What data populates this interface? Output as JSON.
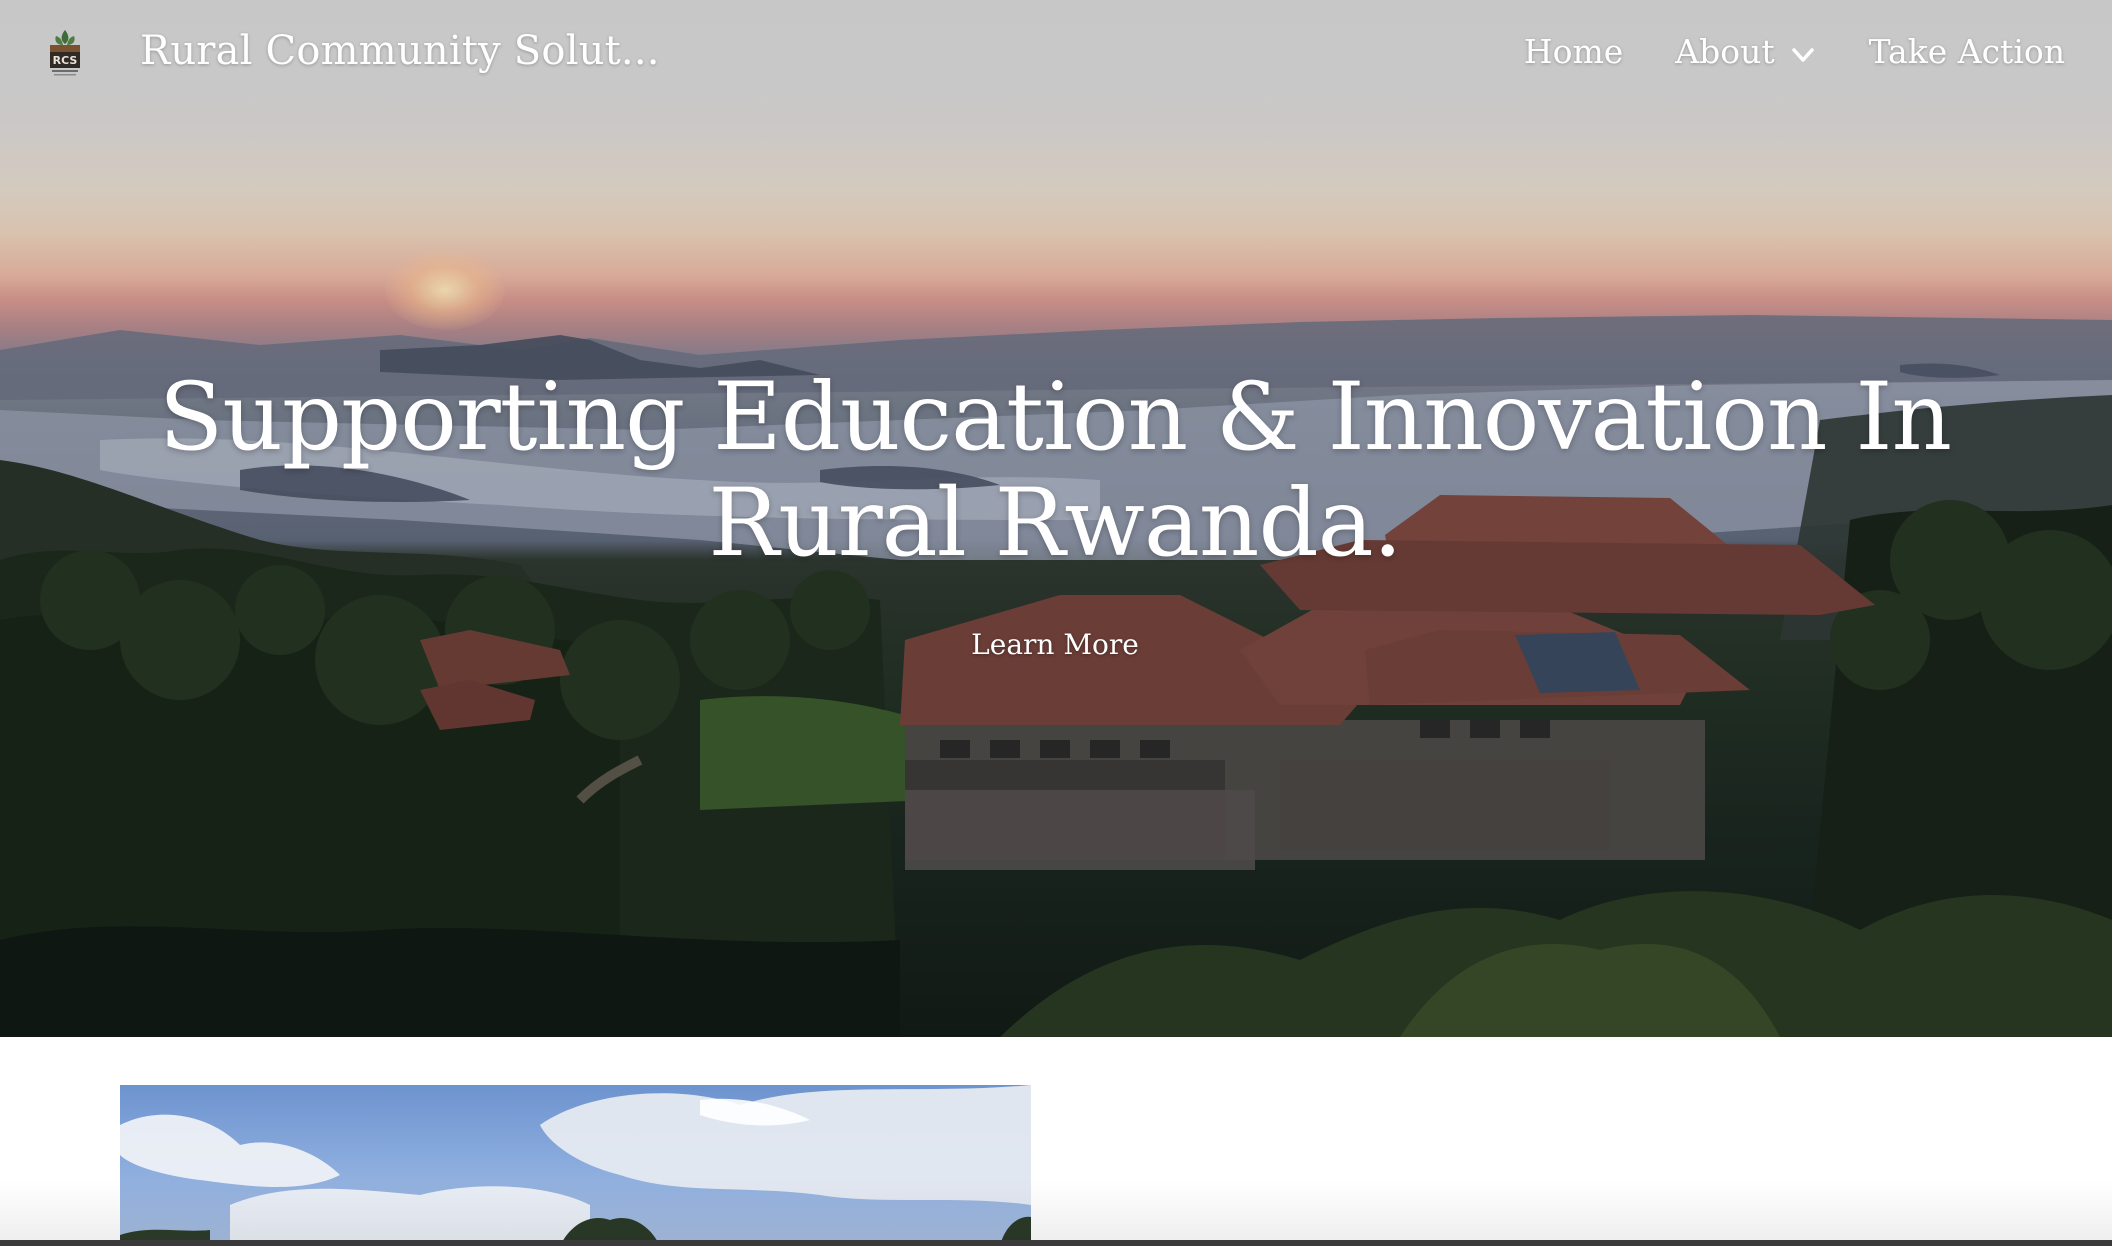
{
  "header": {
    "site_title": "Rural Community Solut...",
    "logo": {
      "icon": "rcs-logo-icon",
      "text": "RCS"
    }
  },
  "nav": {
    "items": [
      {
        "label": "Home"
      },
      {
        "label": "About",
        "icon": "chevron-down-icon"
      },
      {
        "label": "Take Action"
      }
    ]
  },
  "hero": {
    "heading_line1": "Supporting Education & Innovation In",
    "heading_line2": "Rural Rwanda.",
    "cta_label": "Learn More",
    "image": "sunrise-over-hills-and-lodge"
  },
  "content": {
    "image": "sky-with-clouds-and-trees"
  },
  "colors": {
    "text_on_hero": "#ffffff",
    "page_background": "#ffffff",
    "logo_green": "#3f6b3a"
  }
}
